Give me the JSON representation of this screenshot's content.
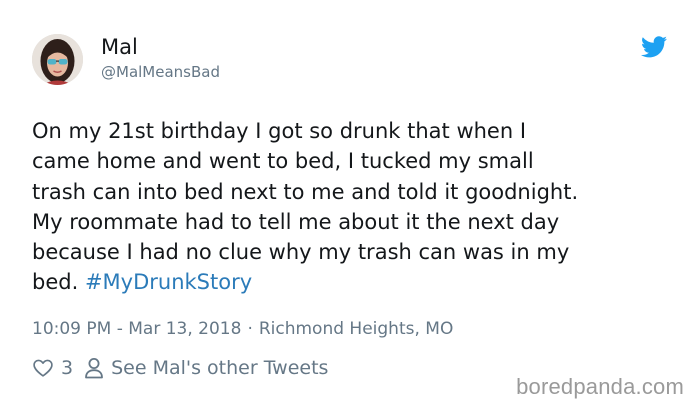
{
  "tweet": {
    "author": {
      "display_name": "Mal",
      "handle": "@MalMeansBad",
      "avatar_icon": "profile-photo"
    },
    "text": "On my 21st birthday I got so drunk that when I\ncame home and went to bed, I tucked my small\ntrash can into bed next to me and told it goodnight.\nMy roommate had to tell me about it the next day\nbecause I had no clue why my trash can was in my\nbed. ",
    "hashtag": "#MyDrunkStory",
    "time": "10:09 PM - Mar 13, 2018",
    "separator": "·",
    "location": "Richmond Heights, MO",
    "like_count": "3",
    "see_other_label": "See Mal's other Tweets",
    "platform_icon": "twitter-bird-icon"
  },
  "watermark": "boredpanda.com",
  "colors": {
    "text": "#14171a",
    "muted": "#657786",
    "link": "#2b7bb9",
    "twitter_blue": "#1da1f2",
    "watermark": "#9a9a9a",
    "background": "#ffffff"
  }
}
